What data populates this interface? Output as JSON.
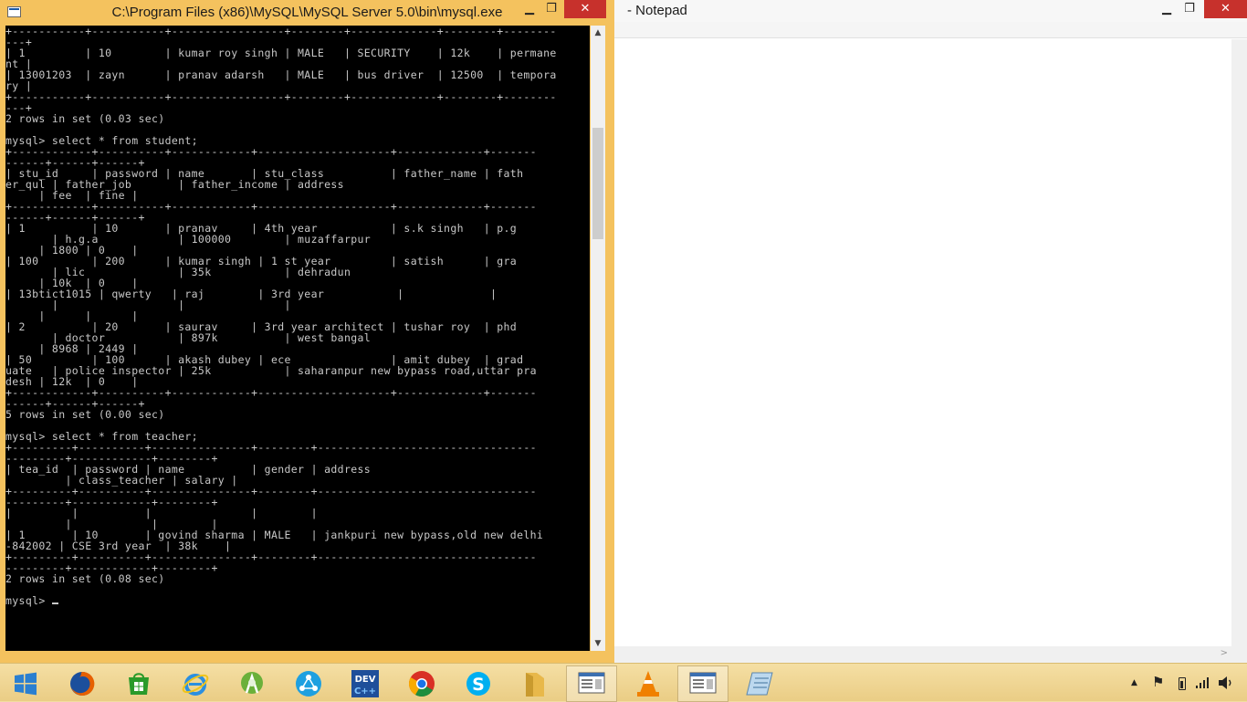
{
  "console": {
    "title": "C:\\Program Files (x86)\\MySQL\\MySQL Server 5.0\\bin\\mysql.exe",
    "min_glyph": "▁",
    "max_glyph": "❐",
    "close_glyph": "✕",
    "scroll_up": "▲",
    "scroll_down": "▼",
    "output": "+-----------+-----------+-----------------+--------+-------------+--------+--------\n---+\n| 1         | 10        | kumar roy singh | MALE   | SECURITY    | 12k    | permane\nnt |\n| 13001203  | zayn      | pranav adarsh   | MALE   | bus driver  | 12500  | tempora\nry |\n+-----------+-----------+-----------------+--------+-------------+--------+--------\n---+\n2 rows in set (0.03 sec)\n\nmysql> select * from student;\n+------------+----------+------------+--------------------+-------------+-------\n------+------+------+\n| stu_id     | password | name       | stu_class          | father_name | fath\ner_qul | father_job       | father_income | address\n     | fee  | fine |\n+------------+----------+------------+--------------------+-------------+-------\n------+------+------+\n| 1          | 10       | pranav     | 4th year           | s.k singh   | p.g\n       | h.g.a            | 100000        | muzaffarpur\n     | 1800 | 0    |\n| 100        | 200      | kumar singh | 1 st year         | satish      | gra\n       | lic              | 35k           | dehradun\n     | 10k  | 0    |\n| 13btict1015 | qwerty   | raj        | 3rd year           |             |\n       |                  |               |\n     |      |      |\n| 2          | 20       | saurav     | 3rd year architect | tushar roy  | phd\n       | doctor           | 897k          | west bangal\n     | 8968 | 2449 |\n| 50         | 100      | akash dubey | ece               | amit dubey  | grad\nuate   | police inspector | 25k           | saharanpur new bypass road,uttar pra\ndesh | 12k  | 0    |\n+------------+----------+------------+--------------------+-------------+-------\n------+------+------+\n5 rows in set (0.00 sec)\n\nmysql> select * from teacher;\n+---------+----------+---------------+--------+---------------------------------\n---------+------------+--------+\n| tea_id  | password | name          | gender | address\n         | class_teacher | salary |\n+---------+----------+---------------+--------+---------------------------------\n---------+------------+--------+\n|         |          |               |        |\n         |            |        |\n| 1       | 10       | govind sharma | MALE   | jankpuri new bypass,old new delhi\n-842002 | CSE 3rd year  | 38k    |\n+---------+----------+---------------+--------+---------------------------------\n---------+------------+--------+\n2 rows in set (0.08 sec)\n\nmysql> "
  },
  "notepad": {
    "title": "- Notepad",
    "min_glyph": "▁",
    "max_glyph": "❐",
    "close_glyph": "✕",
    "hscroll_right": ">"
  },
  "taskbar": {
    "items": [
      {
        "name": "start-button",
        "icon": "windows-logo-icon",
        "color": "#2b7fd0"
      },
      {
        "name": "firefox",
        "icon": "firefox-icon",
        "color": "#e66000"
      },
      {
        "name": "store",
        "icon": "store-icon",
        "color": "#2a9a2a"
      },
      {
        "name": "internet-explorer",
        "icon": "internet-explorer-icon",
        "color": "#2b8fe0"
      },
      {
        "name": "android-studio",
        "icon": "android-studio-icon",
        "color": "#6bb03a"
      },
      {
        "name": "share-app",
        "icon": "share-icon",
        "color": "#1fa0e0"
      },
      {
        "name": "dev-cpp",
        "icon": "dev-cpp-icon",
        "label": "DEV",
        "color": "#1f4f9a"
      },
      {
        "name": "chrome",
        "icon": "chrome-icon",
        "color": "#d93025"
      },
      {
        "name": "skype",
        "icon": "skype-icon",
        "color": "#00aff0"
      },
      {
        "name": "file-explorer",
        "icon": "folder-icon",
        "color": "#e8b84a"
      },
      {
        "name": "mysql-console-task",
        "icon": "console-window-icon",
        "color": "#3c6fb0"
      },
      {
        "name": "vlc",
        "icon": "vlc-cone-icon",
        "color": "#f08000"
      },
      {
        "name": "notepad-task",
        "icon": "notepad-window-icon",
        "color": "#3c6fb0"
      },
      {
        "name": "notepad-app",
        "icon": "notepad-pad-icon",
        "color": "#7fb0d8"
      }
    ],
    "tray": {
      "arrow": "▲",
      "flag": "⚑"
    }
  }
}
